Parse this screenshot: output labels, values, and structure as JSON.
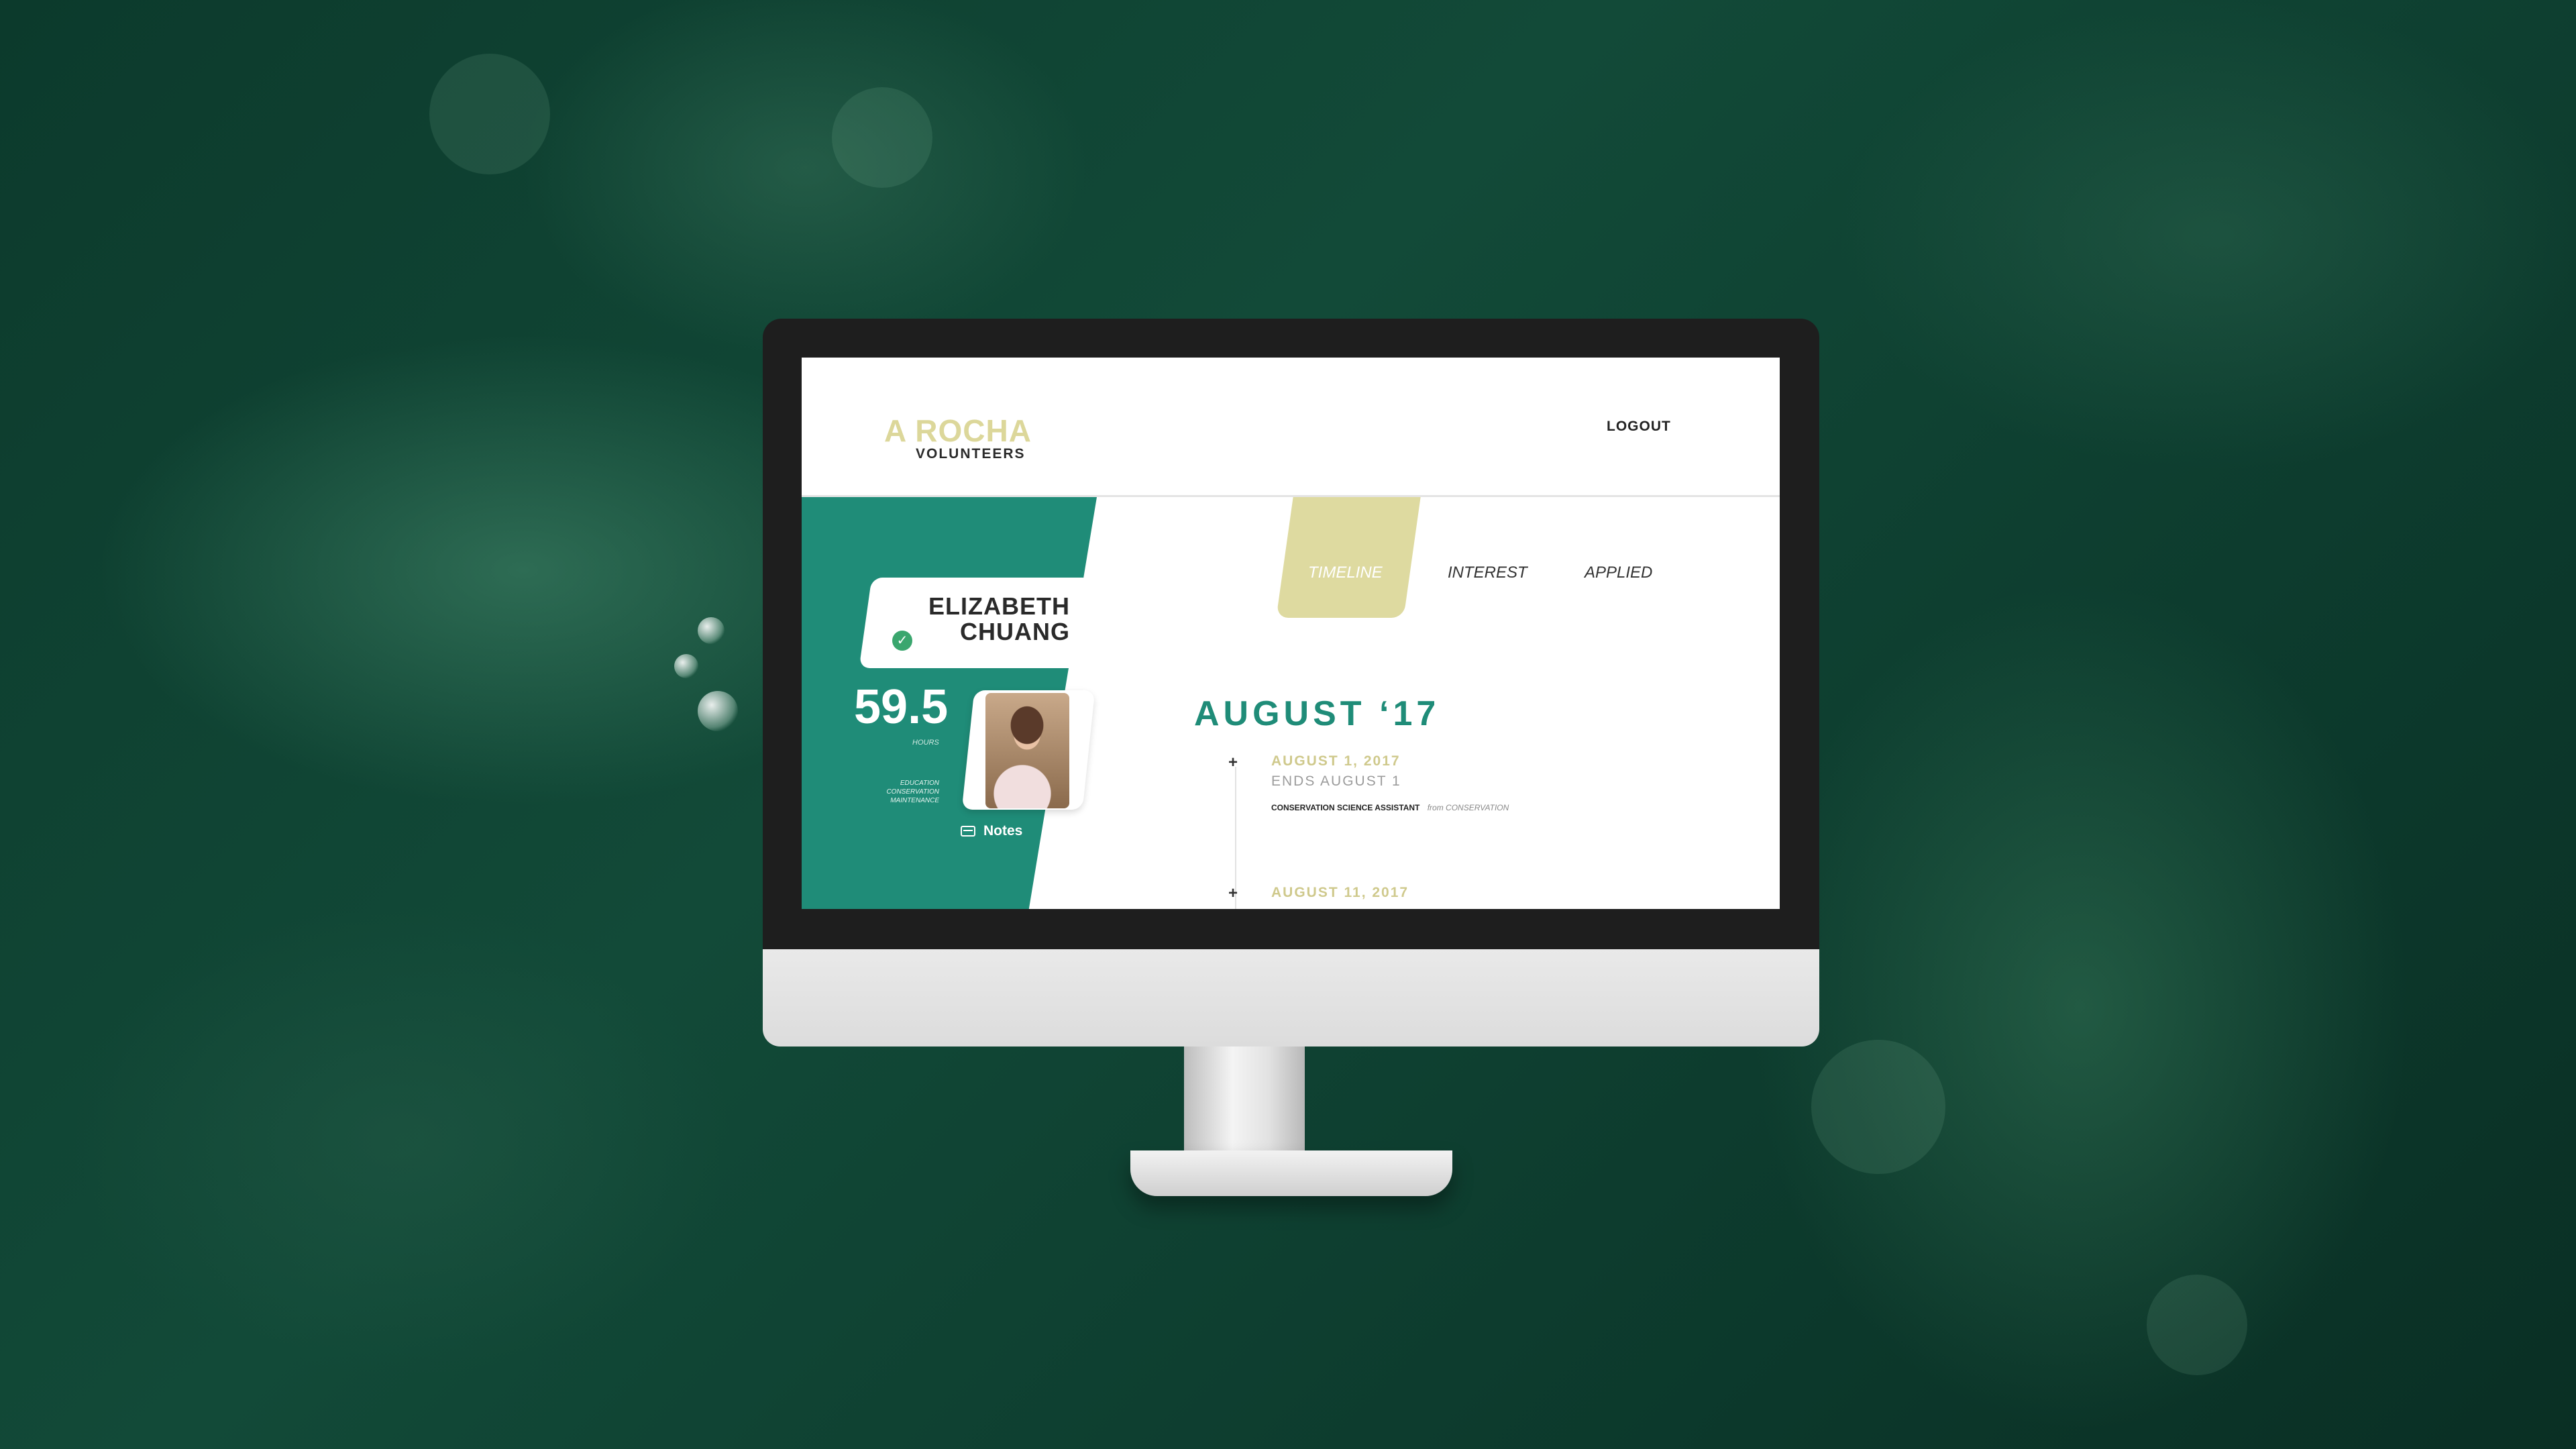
{
  "brand": {
    "name": "A ROCHA",
    "subtitle": "VOLUNTEERS",
    "accent": "#1f8c78",
    "gold": "#dcd79a"
  },
  "header": {
    "logout_label": "LOGOUT"
  },
  "profile": {
    "name_line1": "ELIZABETH",
    "name_line2": "CHUANG",
    "verified_icon": "check-circle-icon",
    "hours": "59.5",
    "hours_label": "HOURS",
    "tags": [
      "EDUCATION",
      "CONSERVATION",
      "MAINTENANCE"
    ],
    "notes_label": "Notes",
    "notes_icon": "envelope-icon"
  },
  "tabs": [
    {
      "label": "TIMELINE",
      "active": true
    },
    {
      "label": "INTEREST",
      "active": false
    },
    {
      "label": "APPLIED",
      "active": false
    }
  ],
  "timeline": {
    "month": "AUGUST ‘17",
    "events": [
      {
        "date": "AUGUST 1, 2017",
        "ends": "ENDS AUGUST 1",
        "role": "CONSERVATION SCIENCE ASSISTANT",
        "from": "from CONSERVATION"
      },
      {
        "date": "AUGUST 11, 2017"
      }
    ]
  }
}
